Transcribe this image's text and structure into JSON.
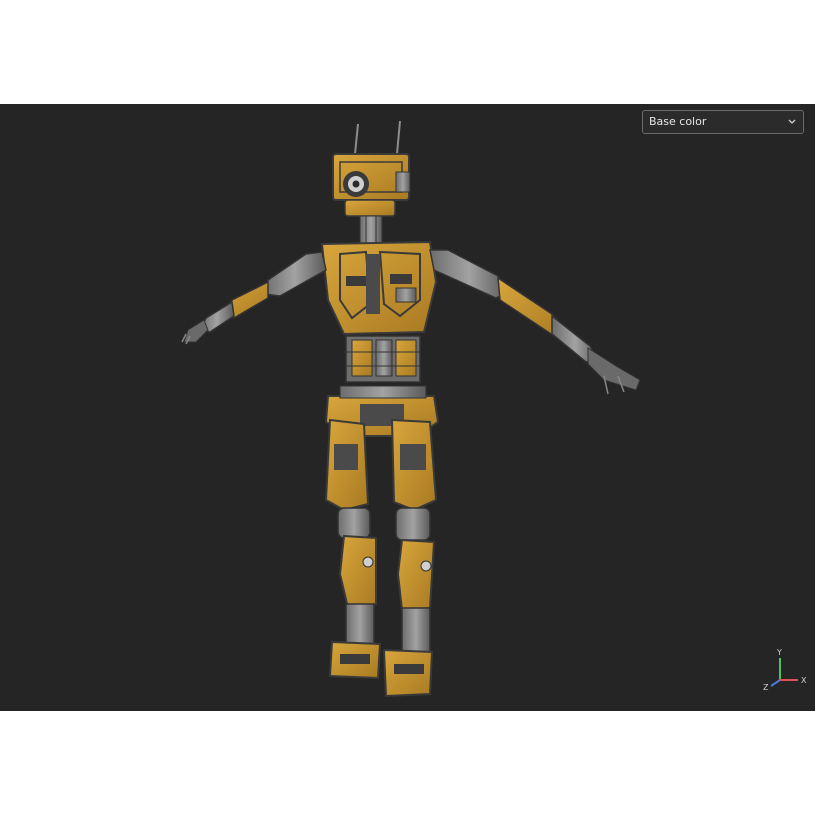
{
  "viewer": {
    "channel_select": {
      "selected": "Base color",
      "icon": "chevron-down-icon"
    },
    "axis_gizmo": {
      "x_label": "X",
      "y_label": "Y",
      "z_label": "Z",
      "x_color": "#e05050",
      "y_color": "#4fc06a",
      "z_color": "#4a78d8"
    },
    "model": {
      "description_icon": "robot-model",
      "primary_color": "#c9962e",
      "secondary_color": "#8a8a8a",
      "dark_color": "#3a3a3a"
    },
    "colors": {
      "viewport_bg": "#252525",
      "page_bg": "#ffffff"
    }
  }
}
